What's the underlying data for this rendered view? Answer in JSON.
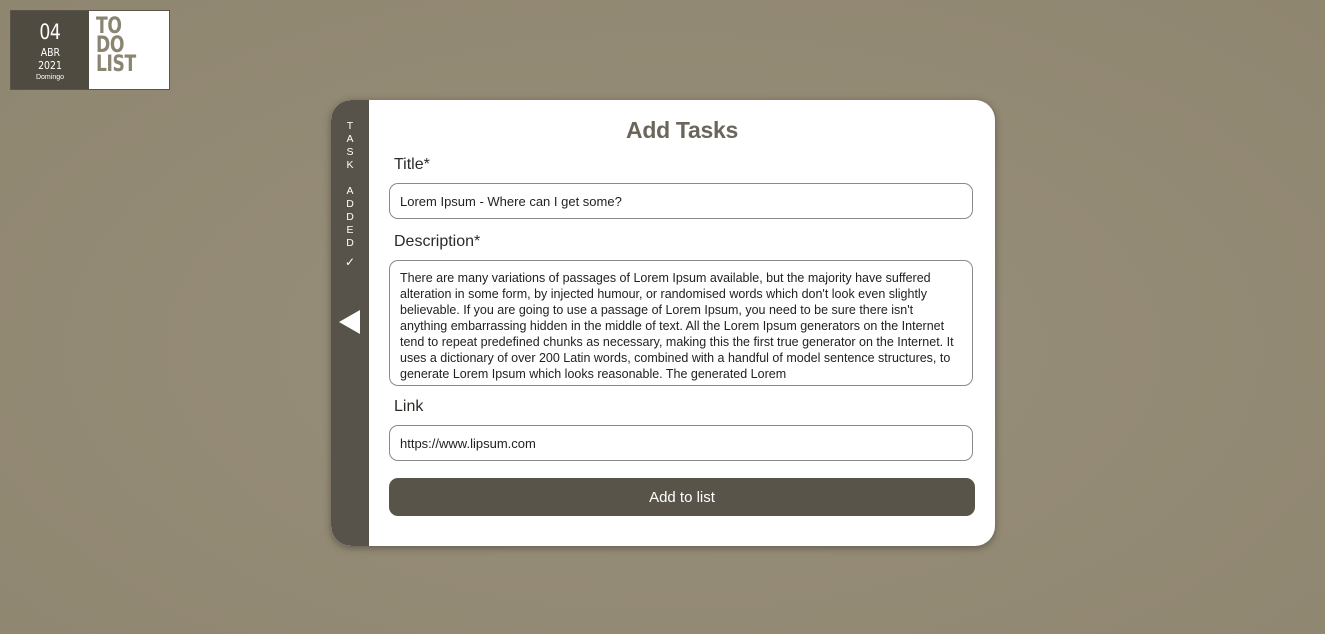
{
  "logo": {
    "day": "04",
    "month": "ABR",
    "year": "2021",
    "weekday": "Domingo",
    "brand_lines": [
      "TO",
      "DO",
      "LIST"
    ]
  },
  "side_panel": {
    "status_word_1": [
      "T",
      "A",
      "S",
      "K"
    ],
    "status_word_2": [
      "A",
      "D",
      "D",
      "E",
      "D"
    ],
    "check_mark": "✓",
    "back_icon": "triangle-left-icon"
  },
  "form": {
    "heading": "Add Tasks",
    "title_label": "Title*",
    "title_value": "Lorem Ipsum - Where can I get some?",
    "description_label": "Description*",
    "description_value": "There are many variations of passages of Lorem Ipsum available, but the majority have suffered alteration in some form, by injected humour, or randomised words which don't look even slightly believable. If you are going to use a passage of Lorem Ipsum, you need to be sure there isn't anything embarrassing hidden in the middle of text. All the Lorem Ipsum generators on the Internet tend to repeat predefined chunks as necessary, making this the first true generator on the Internet. It uses a dictionary of over 200 Latin words, combined with a handful of model sentence structures, to generate Lorem Ipsum which looks reasonable. The generated Lorem",
    "link_label": "Link",
    "link_value": "https://www.lipsum.com",
    "submit_label": "Add to list"
  },
  "colors": {
    "background": "#948b76",
    "panel_dark": "#57534a",
    "heading": "#6b665b",
    "card": "#ffffff"
  }
}
